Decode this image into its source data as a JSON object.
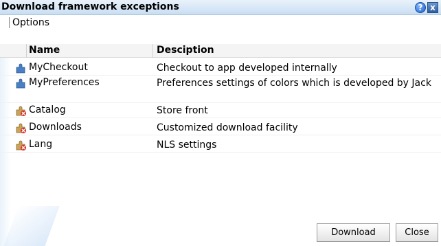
{
  "window": {
    "title": "Download framework exceptions",
    "help_label": "?",
    "close_label": "x"
  },
  "toolbar": {
    "options_label": "Options"
  },
  "table": {
    "headers": {
      "name": "Name",
      "description": "Desciption"
    },
    "rows": [
      {
        "name": "MyCheckout",
        "description": "Checkout to app developed internally",
        "icon": "puzzle-icon"
      },
      {
        "name": "MyPreferences",
        "description": "Preferences settings of colors which is developed by Jack",
        "icon": "puzzle-icon"
      },
      {
        "name": "Catalog",
        "description": "Store front",
        "icon": "puzzle-error-icon"
      },
      {
        "name": " Downloads",
        "description": "Customized download facility",
        "icon": "puzzle-error-icon"
      },
      {
        "name": "Lang",
        "description": "NLS settings",
        "icon": "puzzle-error-icon"
      }
    ]
  },
  "buttons": {
    "download": "Download",
    "close": "Close"
  },
  "colors": {
    "titlebar": "#c9def2",
    "help": "#1f5fc8",
    "error": "#d9302b",
    "puzzle": "#4a7fc4"
  }
}
